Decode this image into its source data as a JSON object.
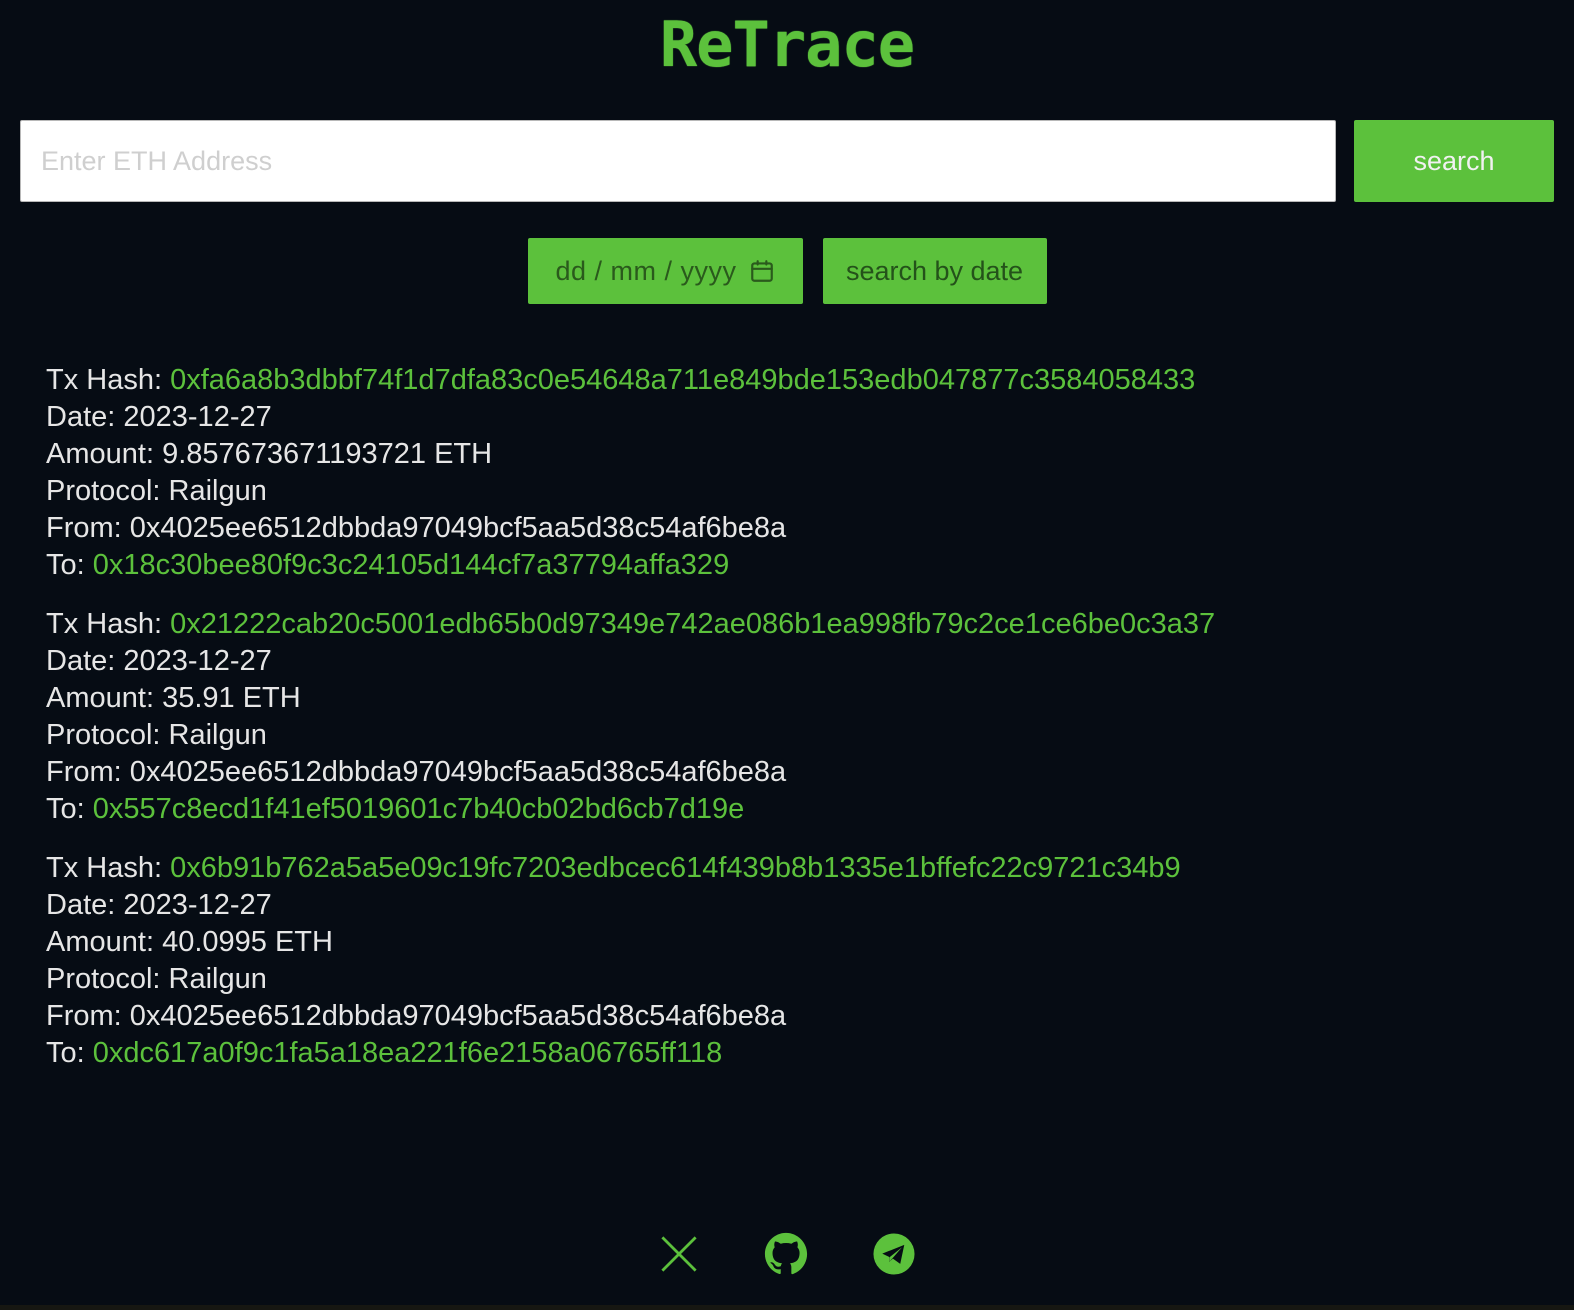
{
  "header": {
    "title": "ReTrace",
    "brand_color": "#5cc13c"
  },
  "theme": {
    "background": "#060c14",
    "accent_green": "#5cc13c",
    "text_white": "#e6e6e6",
    "date_text": "#2a5a1c"
  },
  "search": {
    "address_placeholder": "Enter ETH Address",
    "address_value": "",
    "search_label": "search"
  },
  "date_search": {
    "date_placeholder": "dd / mm / yyyy",
    "date_value": "",
    "calendar_icon": "calendar-icon",
    "search_by_date_label": "search by date"
  },
  "labels": {
    "tx_hash": "Tx Hash:",
    "date": "Date:",
    "amount": "Amount:",
    "protocol": "Protocol:",
    "from": "From:",
    "to": "To:"
  },
  "transactions": [
    {
      "tx_hash": "0xfa6a8b3dbbf74f1d7dfa83c0e54648a711e849bde153edb047877c3584058433",
      "date": "2023-12-27",
      "amount": "9.857673671193721 ETH",
      "protocol": "Railgun",
      "from": "0x4025ee6512dbbda97049bcf5aa5d38c54af6be8a",
      "to": "0x18c30bee80f9c3c24105d144cf7a37794affa329"
    },
    {
      "tx_hash": "0x21222cab20c5001edb65b0d97349e742ae086b1ea998fb79c2ce1ce6be0c3a37",
      "date": "2023-12-27",
      "amount": "35.91 ETH",
      "protocol": "Railgun",
      "from": "0x4025ee6512dbbda97049bcf5aa5d38c54af6be8a",
      "to": "0x557c8ecd1f41ef5019601c7b40cb02bd6cb7d19e"
    },
    {
      "tx_hash": "0x6b91b762a5a5e09c19fc7203edbcec614f439b8b1335e1bffefc22c9721c34b9",
      "date": "2023-12-27",
      "amount": "40.0995 ETH",
      "protocol": "Railgun",
      "from": "0x4025ee6512dbbda97049bcf5aa5d38c54af6be8a",
      "to": "0xdc617a0f9c1fa5a18ea221f6e2158a06765ff118"
    }
  ],
  "footer": {
    "socials": [
      {
        "name": "x-twitter-icon"
      },
      {
        "name": "github-icon"
      },
      {
        "name": "telegram-icon"
      }
    ]
  }
}
